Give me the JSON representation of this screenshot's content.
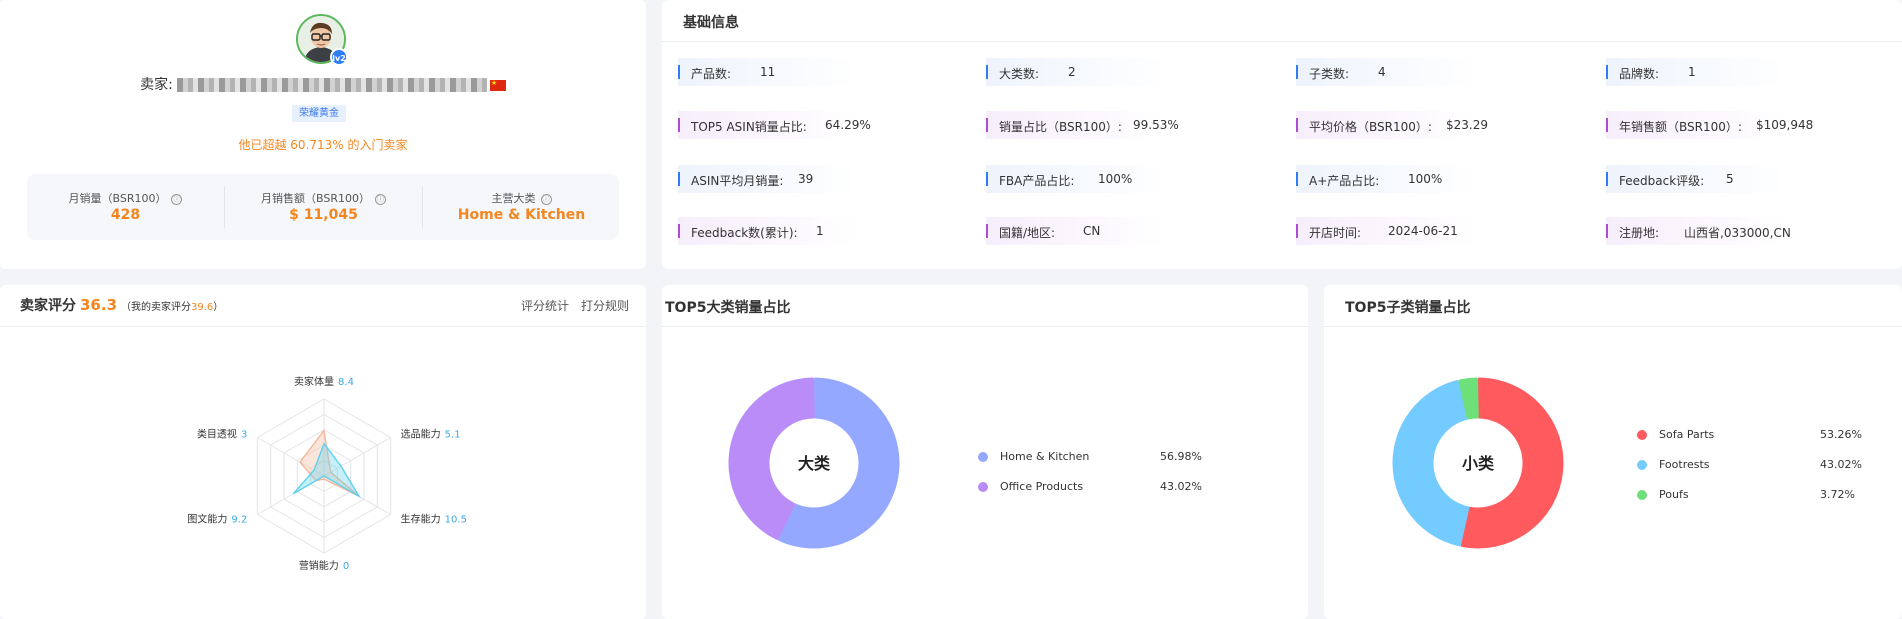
{
  "seller": {
    "prefix": "卖家:",
    "tier": "荣耀黄金",
    "avatar_level": "lv2",
    "beat_text": "他已超越 60.713% 的入门卖家",
    "stats": [
      {
        "label": "月销量（BSR100）",
        "value": "428"
      },
      {
        "label": "月销售额（BSR100）",
        "value": "$ 11,045"
      },
      {
        "label": "主营大类",
        "value": "Home & Kitchen"
      }
    ],
    "info_icon": "ⓘ"
  },
  "basic_info": {
    "title": "基础信息",
    "rows": [
      [
        {
          "label": "产品数:",
          "value": "11"
        },
        {
          "label": "大类数:",
          "value": "2"
        },
        {
          "label": "子类数:",
          "value": "4"
        },
        {
          "label": "品牌数:",
          "value": "1"
        }
      ],
      [
        {
          "label": "TOP5 ASIN销量占比:",
          "value": "64.29%"
        },
        {
          "label": "销量占比（BSR100）:",
          "value": "99.53%"
        },
        {
          "label": "平均价格（BSR100）:",
          "value": "$23.29"
        },
        {
          "label": "年销售额（BSR100）:",
          "value": "$109,948"
        }
      ],
      [
        {
          "label": "ASIN平均月销量:",
          "value": "39"
        },
        {
          "label": "FBA产品占比:",
          "value": "100%"
        },
        {
          "label": "A+产品占比:",
          "value": "100%"
        },
        {
          "label": "Feedback评级:",
          "value": "5"
        }
      ],
      [
        {
          "label": "Feedback数(累计):",
          "value": "1"
        },
        {
          "label": "国籍/地区:",
          "value": "CN"
        },
        {
          "label": "开店时间:",
          "value": "2024-06-21"
        },
        {
          "label": "注册地:",
          "value": "山西省,033000,CN"
        }
      ]
    ]
  },
  "score": {
    "title": "卖家评分",
    "value": "36.3",
    "my_prefix": "（我的卖家评分",
    "my_value": "39.6",
    "my_suffix": "）",
    "links": [
      "评分统计",
      "打分规则"
    ],
    "dimensions": [
      {
        "name": "卖家体量",
        "value": 8.4,
        "label": "8.4"
      },
      {
        "name": "选品能力",
        "value": 5.1,
        "label": "5.1"
      },
      {
        "name": "生存能力",
        "value": 10.5,
        "label": "10.5"
      },
      {
        "name": "营销能力",
        "value": 0,
        "label": "0"
      },
      {
        "name": "图文能力",
        "value": 9.2,
        "label": "9.2"
      },
      {
        "name": "类目透视",
        "value": 3,
        "label": "3"
      }
    ],
    "compare_values": [
      11.8,
      2.0,
      10.5,
      0.8,
      2.4,
      7.2
    ],
    "max": 20,
    "colors": {
      "seller": "#5fd2ee",
      "compare": "#f4b89a",
      "label_value": "#3aa7e6"
    }
  },
  "top5_category": {
    "title": "TOP5大类销量占比",
    "center_label": "大类",
    "items": [
      {
        "name": "Home & Kitchen",
        "pct": "56.98%",
        "value": 56.98,
        "color": "#95a8ff"
      },
      {
        "name": "Office Products",
        "pct": "43.02%",
        "value": 43.02,
        "color": "#b98cf7"
      }
    ]
  },
  "top5_subcategory": {
    "title": "TOP5子类销量占比",
    "center_label": "小类",
    "items": [
      {
        "name": "Sofa Parts",
        "pct": "53.26%",
        "value": 53.26,
        "color": "#ff5b5f"
      },
      {
        "name": "Footrests",
        "pct": "43.02%",
        "value": 43.02,
        "color": "#74cbff"
      },
      {
        "name": "Poufs",
        "pct": "3.72%",
        "value": 3.72,
        "color": "#6ee07a"
      }
    ]
  }
}
